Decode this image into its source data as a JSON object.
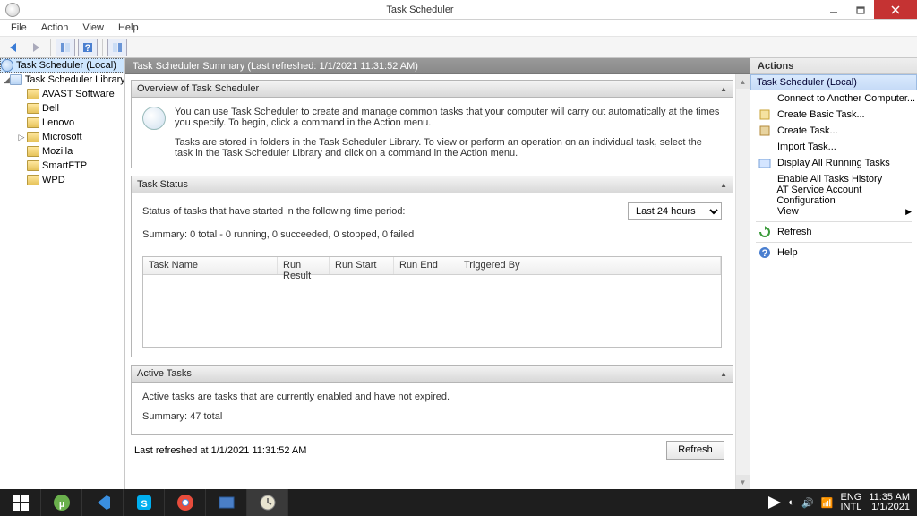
{
  "title": "Task Scheduler",
  "menu": [
    "File",
    "Action",
    "View",
    "Help"
  ],
  "tree": {
    "root": "Task Scheduler (Local)",
    "lib": "Task Scheduler Library",
    "children": [
      "AVAST Software",
      "Dell",
      "Lenovo",
      "Microsoft",
      "Mozilla",
      "SmartFTP",
      "WPD"
    ]
  },
  "summary_header": "Task Scheduler Summary (Last refreshed: 1/1/2021 11:31:52 AM)",
  "overview": {
    "title": "Overview of Task Scheduler",
    "p1": "You can use Task Scheduler to create and manage common tasks that your computer will carry out automatically at the times you specify. To begin, click a command in the Action menu.",
    "p2": "Tasks are stored in folders in the Task Scheduler Library. To view or perform an operation on an individual task, select the task in the Task Scheduler Library and click on a command in the Action menu."
  },
  "status": {
    "title": "Task Status",
    "line1": "Status of tasks that have started in the following time period:",
    "period": "Last 24 hours",
    "summary": "Summary: 0 total - 0 running, 0 succeeded, 0 stopped, 0 failed",
    "cols": [
      "Task Name",
      "Run Result",
      "Run Start",
      "Run End",
      "Triggered By"
    ]
  },
  "active": {
    "title": "Active Tasks",
    "line1": "Active tasks are tasks that are currently enabled and have not expired.",
    "summary": "Summary: 47 total"
  },
  "last_refreshed": "Last refreshed at 1/1/2021 11:31:52 AM",
  "refresh_btn": "Refresh",
  "actions": {
    "title": "Actions",
    "subtitle": "Task Scheduler (Local)",
    "items": [
      "Connect to Another Computer...",
      "Create Basic Task...",
      "Create Task...",
      "Import Task...",
      "Display All Running Tasks",
      "Enable All Tasks History",
      "AT Service Account Configuration",
      "View",
      "Refresh",
      "Help"
    ]
  },
  "tray": {
    "lang1": "ENG",
    "lang2": "INTL",
    "time": "11:35 AM",
    "date": "1/1/2021"
  }
}
